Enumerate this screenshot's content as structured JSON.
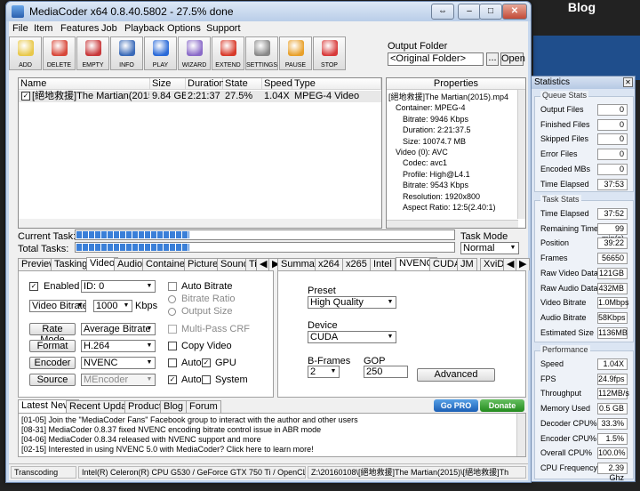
{
  "background": {
    "blog_label": "Blog"
  },
  "window": {
    "title": "MediaCoder x64 0.8.40.5802 - 27.5% done"
  },
  "menu": [
    "File",
    "Item",
    "Features",
    "Job",
    "Playback",
    "Options",
    "Support"
  ],
  "toolbar": [
    {
      "label": "ADD",
      "icon": "add-icon",
      "color": "#e8c84a"
    },
    {
      "label": "DELETE",
      "icon": "delete-icon",
      "color": "#d8483a"
    },
    {
      "label": "EMPTY",
      "icon": "empty-icon",
      "color": "#c8383a"
    },
    {
      "label": "INFO",
      "icon": "info-icon",
      "color": "#3a6ab8"
    },
    {
      "label": "PLAY",
      "icon": "play-icon",
      "color": "#2a6ad8"
    },
    {
      "label": "WIZARD",
      "icon": "wizard-icon",
      "color": "#8a6ac8"
    },
    {
      "label": "EXTEND",
      "icon": "extend-icon",
      "color": "#d83a2a"
    },
    {
      "label": "SETTINGS",
      "icon": "settings-icon",
      "color": "#888888"
    },
    {
      "label": "PAUSE",
      "icon": "pause-icon",
      "color": "#e8a02a"
    },
    {
      "label": "STOP",
      "icon": "stop-icon",
      "color": "#d83a3a"
    }
  ],
  "output_folder": {
    "label": "Output Folder",
    "value": "<Original Folder>",
    "browse": "...",
    "open": "Open"
  },
  "filelist": {
    "columns": [
      "Name",
      "Size",
      "Duration",
      "State",
      "Speed",
      "Type"
    ],
    "row": {
      "name": "[絕地救援]The Martian(2015).mp4",
      "size": "9.84 GB",
      "duration": "2:21:37",
      "state": "27.5%",
      "speed": "1.04X",
      "type": "MPEG-4 Video"
    }
  },
  "properties": {
    "header": "Properties",
    "lines": [
      "[絕地救援]The Martian(2015).mp4",
      "Container: MPEG-4",
      "Bitrate: 9946 Kbps",
      "Duration: 2:21:37.5",
      "Size: 10074.7 MB",
      "Video (0): AVC",
      "Codec: avc1",
      "Profile: High@L4.1",
      "Bitrate: 9543 Kbps",
      "Resolution: 1920x800",
      "Aspect Ratio: 12:5(2.40:1)"
    ]
  },
  "progress": {
    "current_label": "Current Task:",
    "total_label": "Total Tasks:",
    "current": 0.275,
    "total": 0.275
  },
  "task_mode": {
    "label": "Task Mode",
    "value": "Normal"
  },
  "left_tabs": [
    "Preview",
    "Tasking",
    "Video",
    "Audio",
    "Container",
    "Picture",
    "Sound",
    "Ti"
  ],
  "video": {
    "enabled_label": "Enabled",
    "id_value": "ID: 0",
    "bitrate_mode": "Video Bitrate",
    "bitrate_value": "1000",
    "kbps": "Kbps",
    "auto_bitrate": "Auto Bitrate",
    "bitrate_ratio": "Bitrate Ratio",
    "output_size": "Output Size",
    "rate_mode_btn": "Rate Mode",
    "rate_mode_value": "Average Bitrate",
    "multipass": "Multi-Pass CRF",
    "format_btn": "Format",
    "format_value": "H.264",
    "copy_video": "Copy Video",
    "encoder_btn": "Encoder",
    "encoder_value": "NVENC",
    "auto1": "Auto",
    "gpu": "GPU",
    "source_btn": "Source",
    "source_value": "MEncoder",
    "auto2": "Auto",
    "system": "System"
  },
  "right_tabs": [
    "Summary",
    "x264",
    "x265",
    "Intel",
    "NVENC",
    "CUDA",
    "JM",
    "XviD"
  ],
  "nvenc": {
    "preset_label": "Preset",
    "preset_value": "High Quality",
    "device_label": "Device",
    "device_value": "CUDA",
    "bframes_label": "B-Frames",
    "bframes_value": "2",
    "gop_label": "GOP",
    "gop_value": "250",
    "advanced_btn": "Advanced"
  },
  "news_tabs": [
    "Latest News",
    "Recent Updates",
    "Products",
    "Blog",
    "Forum"
  ],
  "news": [
    "[01-05] Join the \"MediaCoder Fans\" Facebook group to interact with the author and other users",
    "[08-31] MediaCoder 0.8.37 fixed NVENC encoding bitrate control issue in ABR mode",
    "[04-06] MediaCoder 0.8.34 released with NVENC support and more",
    "[02-15] Interested in using NVENC 5.0 with MediaCoder? Click here to learn more!"
  ],
  "gopro": "Go PRO",
  "donate": "Donate",
  "statusbar": {
    "state": "Transcoding",
    "hw": "Intel(R) Celeron(R) CPU G530 / GeForce GTX 750 Ti / OpenCL",
    "path": "Z:\\20160108\\[絕地救援]The Martian(2015)\\[絕地救援]Th"
  },
  "stats": {
    "title": "Statistics",
    "queue_title": "Queue Stats",
    "queue": [
      {
        "label": "Output Files",
        "value": "0"
      },
      {
        "label": "Finished Files",
        "value": "0"
      },
      {
        "label": "Skipped Files",
        "value": "0"
      },
      {
        "label": "Error Files",
        "value": "0"
      },
      {
        "label": "Encoded MBs",
        "value": "0"
      },
      {
        "label": "Time Elapsed",
        "value": "37:53"
      }
    ],
    "task_title": "Task Stats",
    "task": [
      {
        "label": "Time Elapsed",
        "value": "37:52"
      },
      {
        "label": "Remaining Time",
        "value": "99 min(s)"
      },
      {
        "label": "Position",
        "value": "39:22"
      },
      {
        "label": "Frames",
        "value": "56650"
      },
      {
        "label": "Raw Video Data",
        "value": "121GB"
      },
      {
        "label": "Raw Audio Data",
        "value": "432MB"
      },
      {
        "label": "Video Bitrate",
        "value": "1.0Mbps"
      },
      {
        "label": "Audio Bitrate",
        "value": "58Kbps"
      },
      {
        "label": "Estimated Size",
        "value": "1136MB"
      }
    ],
    "perf_title": "Performance",
    "perf": [
      {
        "label": "Speed",
        "value": "1.04X"
      },
      {
        "label": "FPS",
        "value": "24.9fps"
      },
      {
        "label": "Throughput",
        "value": "112MB/s"
      },
      {
        "label": "Memory Used",
        "value": "0.5 GB"
      },
      {
        "label": "Decoder CPU%",
        "value": "33.3%"
      },
      {
        "label": "Encoder CPU%",
        "value": "1.5%"
      },
      {
        "label": "Overall CPU%",
        "value": "100.0%"
      },
      {
        "label": "CPU Frequency",
        "value": "2.39 Ghz"
      }
    ]
  }
}
